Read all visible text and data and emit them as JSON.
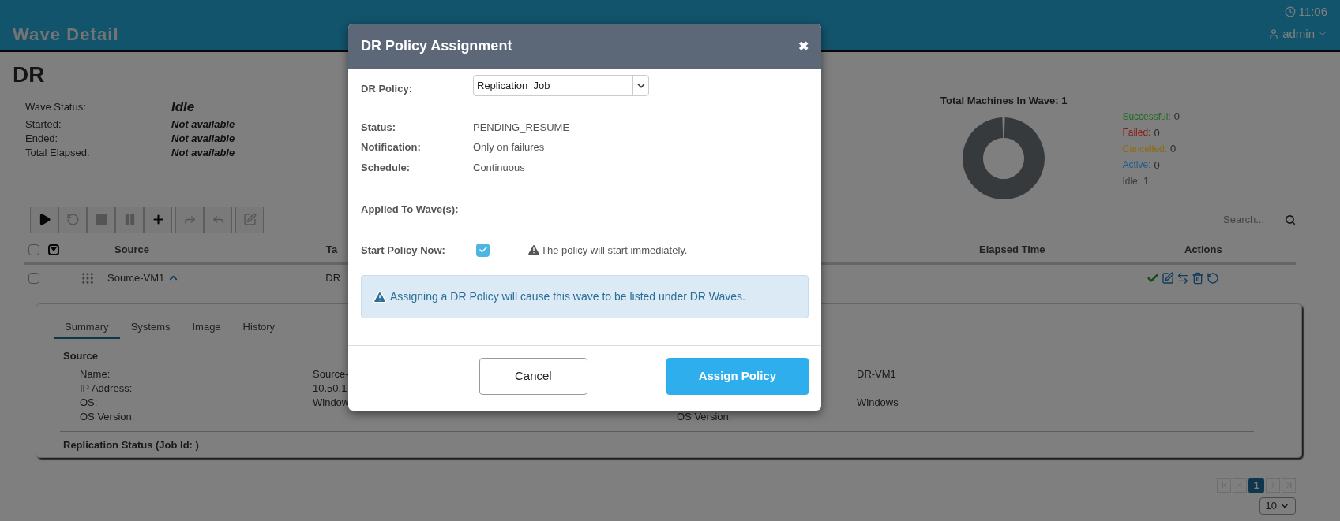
{
  "header": {
    "clock": "11:06",
    "title": "Wave Detail",
    "user": "admin"
  },
  "wave": {
    "name": "DR",
    "fields": [
      {
        "label": "Wave Status:",
        "value": "Idle",
        "kind": "status"
      },
      {
        "label": "Started:",
        "value": "Not available",
        "kind": "info"
      },
      {
        "label": "Ended:",
        "value": "Not available",
        "kind": "info"
      },
      {
        "label": "Total Elapsed:",
        "value": "Not available",
        "kind": "info"
      }
    ]
  },
  "machines": {
    "title": "Total Machines In Wave: 1",
    "legend": [
      {
        "label": "Successful:",
        "value": "0",
        "color": "#1f6b24"
      },
      {
        "label": "Failed:",
        "value": "0",
        "color": "#8b1a1a"
      },
      {
        "label": "Cancelled:",
        "value": "0",
        "color": "#8f6a10"
      },
      {
        "label": "Active:",
        "value": "0",
        "color": "#1f5f8a"
      },
      {
        "label": "Idle:",
        "value": "1",
        "color": "#3a3a3a"
      }
    ]
  },
  "toolbar": [
    {
      "kind": "play",
      "disabled": false
    },
    {
      "kind": "restart",
      "disabled": true
    },
    {
      "kind": "stop",
      "disabled": true
    },
    {
      "kind": "pause",
      "disabled": true
    },
    {
      "kind": "add",
      "disabled": false
    },
    {
      "kind": "forward",
      "disabled": true
    },
    {
      "kind": "back",
      "disabled": true
    },
    {
      "kind": "edit",
      "disabled": true
    }
  ],
  "search": {
    "placeholder": "Search..."
  },
  "table": {
    "select_all": {
      "checked": false
    },
    "columns": [
      "Source",
      "Ta",
      "Elapsed Time",
      "Actions"
    ],
    "rows": [
      {
        "selected": false,
        "source": "Source-VM1",
        "expanded": true,
        "target": "DR"
      }
    ]
  },
  "details": {
    "tabs": [
      {
        "label": "Summary",
        "selected": true
      },
      {
        "label": "Systems",
        "selected": false
      },
      {
        "label": "Image",
        "selected": false
      },
      {
        "label": "History",
        "selected": false
      }
    ],
    "heading": "Source",
    "source_rows": [
      {
        "label": "Name:",
        "value": "Source-"
      },
      {
        "label": "IP Address:",
        "value": "10.50.1"
      },
      {
        "label": "OS:",
        "value": "Window"
      },
      {
        "label": "OS Version:"
      }
    ],
    "target_rows": [
      {
        "value": "DR-VM1"
      },
      {},
      {
        "value": "Windows"
      },
      {
        "label": "OS Version:"
      }
    ],
    "replication": "Replication Status (Job Id: )"
  },
  "pagination": {
    "nav": [
      {
        "kind": "first",
        "disabled": true
      },
      {
        "kind": "prev",
        "disabled": true
      },
      {
        "kind": "next",
        "disabled": true
      },
      {
        "kind": "last",
        "disabled": true
      }
    ],
    "pages": [
      {
        "label": "1",
        "selected": true
      }
    ],
    "page_size": "10"
  },
  "modal": {
    "title": "DR Policy Assignment",
    "close": "✖",
    "policy_label": "DR Policy:",
    "policy_value": "Replication_Job",
    "fields": [
      {
        "label": "Status:",
        "value": "PENDING_RESUME"
      },
      {
        "label": "Notification:",
        "value": "Only on failures"
      },
      {
        "label": "Schedule:",
        "value": "Continuous"
      }
    ],
    "applied_label": "Applied To Wave(s):",
    "start_label": "Start Policy Now:",
    "start_checked": true,
    "start_note": "The policy will start immediately.",
    "info": "Assigning a DR Policy will cause this wave to be listed under DR Waves.",
    "buttons": [
      {
        "label": "Cancel",
        "kind": "secondary"
      },
      {
        "label": "Assign Policy",
        "kind": "primary"
      }
    ]
  }
}
